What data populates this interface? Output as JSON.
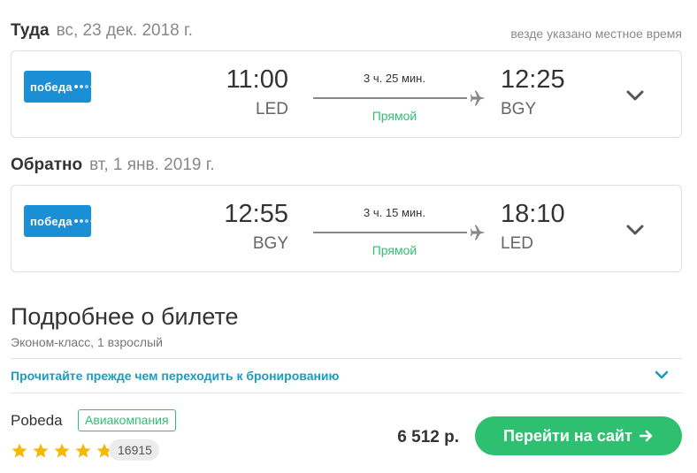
{
  "colors": {
    "accent": "#2fbf71",
    "link": "#1a9dbf",
    "airline_logo": "#1a8fd6",
    "star": "#f5b800"
  },
  "outbound": {
    "direction": "Туда",
    "date": "вс, 23 дек. 2018 г.",
    "timezone_note": "везде указано местное время",
    "airline_logo_text": "победа",
    "dep_time": "11:00",
    "dep_code": "LED",
    "duration": "3 ч. 25 мин.",
    "route_type": "Прямой",
    "arr_time": "12:25",
    "arr_code": "BGY",
    "icons": [
      "plane-icon",
      "chevron-down-icon"
    ]
  },
  "inbound": {
    "direction": "Обратно",
    "date": "вт, 1 янв. 2019 г.",
    "airline_logo_text": "победа",
    "dep_time": "12:55",
    "dep_code": "BGY",
    "duration": "3 ч. 15 мин.",
    "route_type": "Прямой",
    "arr_time": "18:10",
    "arr_code": "LED",
    "icons": [
      "plane-icon",
      "chevron-down-icon"
    ]
  },
  "details": {
    "title": "Подробнее о билете",
    "subtitle": "Эконом-класс, 1 взрослый",
    "read_before_link": "Прочитайте прежде чем переходить к бронированию"
  },
  "offer": {
    "airline_name": "Pobeda",
    "badge": "Авиакомпания",
    "rating_stars": 5,
    "reviews_count": "16915",
    "price": "6 512 р.",
    "cta_label": "Перейти на сайт",
    "cta_icon": "arrow-right-icon"
  }
}
